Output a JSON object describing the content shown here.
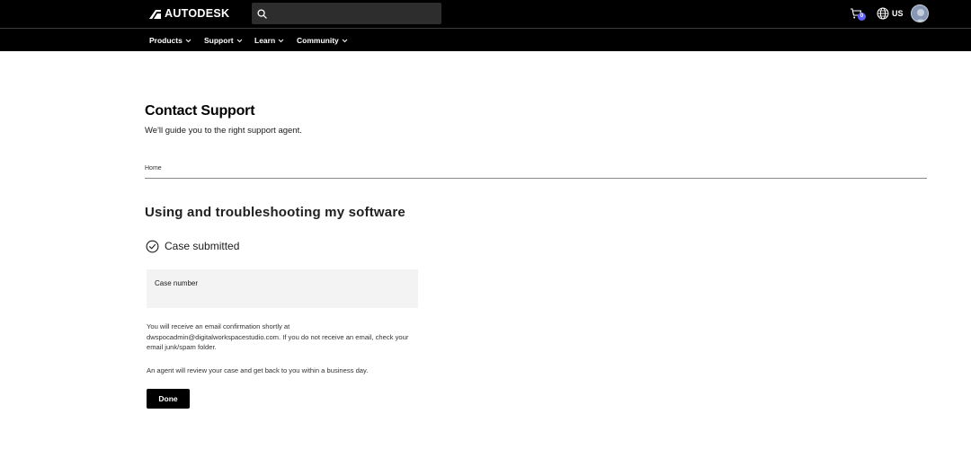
{
  "header": {
    "brand": "AUTODESK",
    "search": {
      "placeholder": "",
      "value": ""
    },
    "cart": {
      "count": "0",
      "icon": "cart-icon"
    },
    "region": {
      "label": "US",
      "icon": "globe-icon"
    },
    "avatar": {
      "icon": "avatar"
    }
  },
  "nav": {
    "items": [
      {
        "label": "Products",
        "icon": "chevron-down-icon"
      },
      {
        "label": "Support",
        "icon": "chevron-down-icon"
      },
      {
        "label": "Learn",
        "icon": "chevron-down-icon"
      },
      {
        "label": "Community",
        "icon": "chevron-down-icon"
      }
    ]
  },
  "page": {
    "title": "Contact Support",
    "subtitle": "We'll guide you to the right support agent.",
    "breadcrumb": "Home"
  },
  "main": {
    "heading": "Using and troubleshooting my software",
    "status": {
      "label": "Case submitted",
      "icon": "check-circle-icon"
    },
    "case": {
      "label": "Case number",
      "value": ""
    },
    "confirmation": "You will receive an email confirmation shortly at dwspocadmin@digitalworkspacestudio.com. If you do not receive an email, check your email junk/spam folder.",
    "review": "An agent will review your case and get back to you within a business day.",
    "done_label": "Done"
  },
  "colors": {
    "header_bg": "#000000",
    "search_bg": "#2d2d2d",
    "cart_badge": "#5f60ff",
    "case_box_bg": "#f3f3f3",
    "button_bg": "#000000"
  }
}
